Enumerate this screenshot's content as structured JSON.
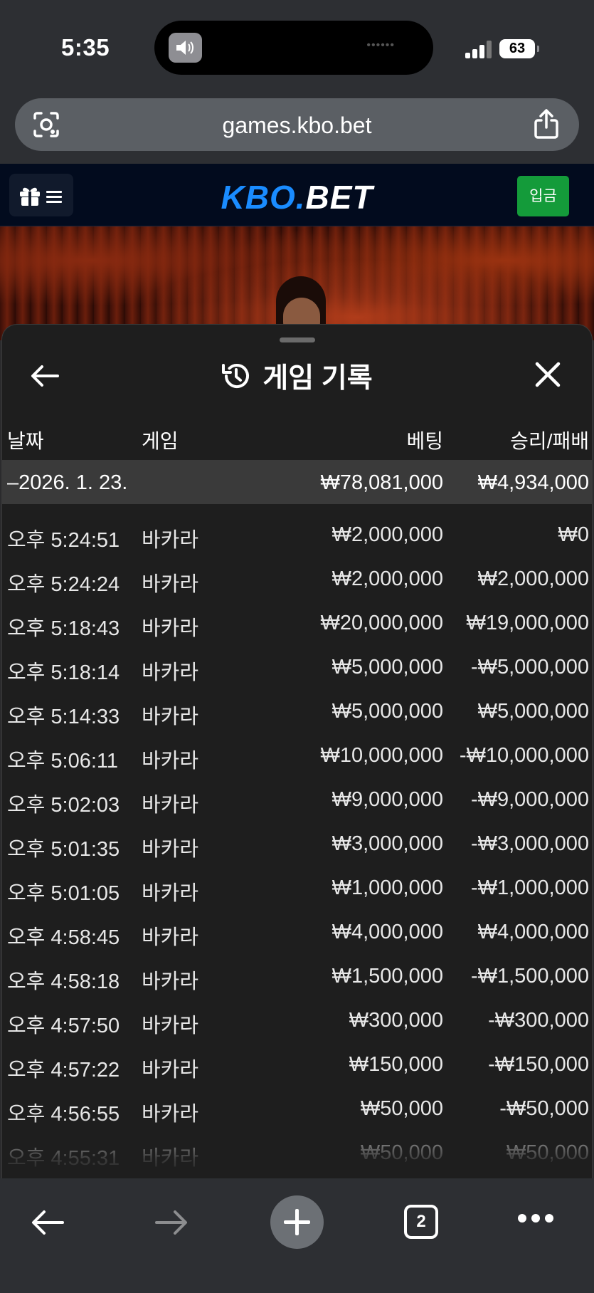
{
  "status_bar": {
    "time": "5:35",
    "battery": "63"
  },
  "browser": {
    "url": "games.kbo.bet",
    "tab_count": "2"
  },
  "site": {
    "logo_part1": "KBO.",
    "logo_part2": "BET",
    "deposit_label": "입금"
  },
  "history": {
    "title": "게임 기록",
    "columns": {
      "date": "날짜",
      "game": "게임",
      "bet": "베팅",
      "win_loss": "승리/패배"
    },
    "group": {
      "date": "–2026. 1. 23.",
      "bet_total": "₩78,081,000",
      "win_total": "₩4,934,000"
    },
    "rows": [
      {
        "time": "오후 5:24:51",
        "game": "바카라",
        "bet": "₩2,000,000",
        "result": "₩0"
      },
      {
        "time": "오후 5:24:24",
        "game": "바카라",
        "bet": "₩2,000,000",
        "result": "₩2,000,000"
      },
      {
        "time": "오후 5:18:43",
        "game": "바카라",
        "bet": "₩20,000,000",
        "result": "₩19,000,000"
      },
      {
        "time": "오후 5:18:14",
        "game": "바카라",
        "bet": "₩5,000,000",
        "result": "-₩5,000,000"
      },
      {
        "time": "오후 5:14:33",
        "game": "바카라",
        "bet": "₩5,000,000",
        "result": "₩5,000,000"
      },
      {
        "time": "오후 5:06:11",
        "game": "바카라",
        "bet": "₩10,000,000",
        "result": "-₩10,000,000"
      },
      {
        "time": "오후 5:02:03",
        "game": "바카라",
        "bet": "₩9,000,000",
        "result": "-₩9,000,000"
      },
      {
        "time": "오후 5:01:35",
        "game": "바카라",
        "bet": "₩3,000,000",
        "result": "-₩3,000,000"
      },
      {
        "time": "오후 5:01:05",
        "game": "바카라",
        "bet": "₩1,000,000",
        "result": "-₩1,000,000"
      },
      {
        "time": "오후 4:58:45",
        "game": "바카라",
        "bet": "₩4,000,000",
        "result": "₩4,000,000"
      },
      {
        "time": "오후 4:58:18",
        "game": "바카라",
        "bet": "₩1,500,000",
        "result": "-₩1,500,000"
      },
      {
        "time": "오후 4:57:50",
        "game": "바카라",
        "bet": "₩300,000",
        "result": "-₩300,000"
      },
      {
        "time": "오후 4:57:22",
        "game": "바카라",
        "bet": "₩150,000",
        "result": "-₩150,000"
      },
      {
        "time": "오후 4:56:55",
        "game": "바카라",
        "bet": "₩50,000",
        "result": "-₩50,000"
      },
      {
        "time": "오후 4:55:31",
        "game": "바카라",
        "bet": "₩50,000",
        "result": "₩50,000"
      }
    ]
  }
}
